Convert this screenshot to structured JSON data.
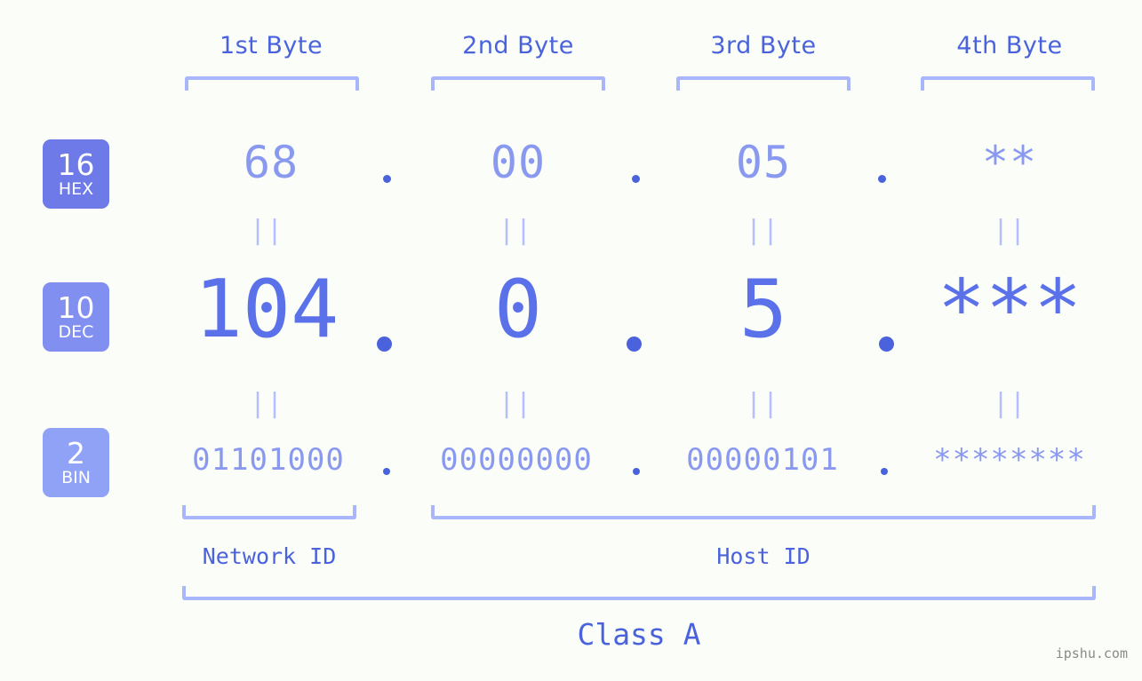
{
  "background_color": "#fbfdf8",
  "accent_colors": {
    "label_blue": "#4a63dd",
    "value_light_blue": "#8a99f0",
    "value_strong_blue": "#5b71e9",
    "bracket_blue": "#aab6fb",
    "badge_hex": "#6d7ae8",
    "badge_dec": "#818ff1",
    "badge_bin": "#8fa2f6",
    "watermark_gray": "#8a8a8a"
  },
  "byte_headers": [
    {
      "label": "1st Byte"
    },
    {
      "label": "2nd Byte"
    },
    {
      "label": "3rd Byte"
    },
    {
      "label": "4th Byte"
    }
  ],
  "rows": [
    {
      "badge_number": "16",
      "badge_name": "HEX",
      "values": [
        "68",
        "00",
        "05",
        "**"
      ],
      "separator": "."
    },
    {
      "badge_number": "10",
      "badge_name": "DEC",
      "values": [
        "104",
        "0",
        "5",
        "***"
      ],
      "separator": "."
    },
    {
      "badge_number": "2",
      "badge_name": "BIN",
      "values": [
        "01101000",
        "00000000",
        "00000101",
        "********"
      ],
      "separator": "."
    }
  ],
  "equality_marks": [
    "||",
    "||",
    "||",
    "||"
  ],
  "segments": {
    "network_id": "Network ID",
    "host_id": "Host ID",
    "class": "Class A"
  },
  "watermark": "ipshu.com"
}
